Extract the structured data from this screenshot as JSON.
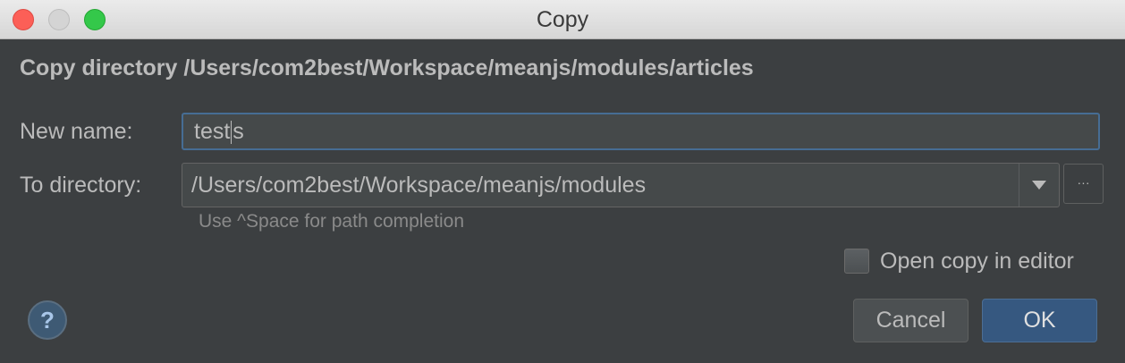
{
  "window": {
    "title": "Copy"
  },
  "header": {
    "text": "Copy directory /Users/com2best/Workspace/meanjs/modules/articles"
  },
  "form": {
    "new_name_label": "New name:",
    "new_name_value_before_caret": "test",
    "new_name_value_after_caret": "s",
    "to_directory_label": "To directory:",
    "to_directory_value": "/Users/com2best/Workspace/meanjs/modules",
    "browse_label": "···",
    "hint": "Use ^Space for path completion"
  },
  "options": {
    "open_copy_label": "Open copy in editor",
    "open_copy_checked": false
  },
  "buttons": {
    "help": "?",
    "cancel": "Cancel",
    "ok": "OK"
  },
  "colors": {
    "background": "#3c3f41",
    "accent": "#365880",
    "focus_border": "#466d94"
  }
}
